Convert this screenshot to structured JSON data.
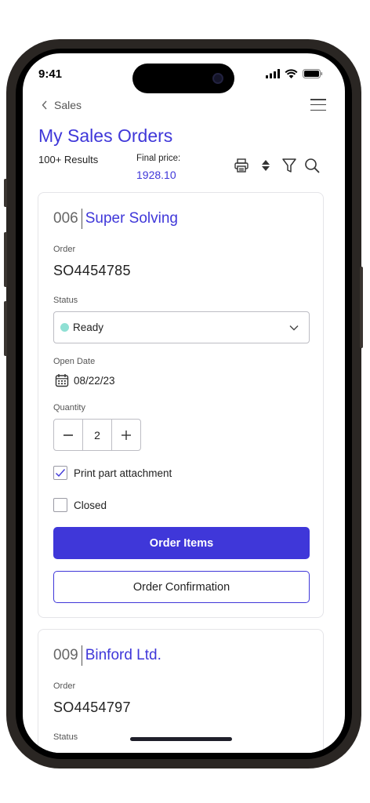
{
  "status_bar": {
    "time": "9:41"
  },
  "nav": {
    "back_label": "Sales"
  },
  "header": {
    "title": "My Sales Orders",
    "results": "100+ Results",
    "final_price_label": "Final  price:",
    "final_price_value": "1928.10"
  },
  "accent_color": "#3f37d9",
  "orders": [
    {
      "number": "006",
      "name": "Super Solving",
      "order_label": "Order",
      "order_no": "SO4454785",
      "status_label": "Status",
      "status_value": "Ready",
      "status_color": "#8fe0d4",
      "open_date_label": "Open Date",
      "open_date": "08/22/23",
      "quantity_label": "Quantity",
      "quantity": "2",
      "print_label": "Print part attachment",
      "print_checked": true,
      "closed_label": "Closed",
      "closed_checked": false,
      "items_button": "Order Items",
      "confirmation_button": "Order Confirmation"
    },
    {
      "number": "009",
      "name": "Binford Ltd.",
      "order_label": "Order",
      "order_no": "SO4454797",
      "status_label": "Status"
    }
  ]
}
